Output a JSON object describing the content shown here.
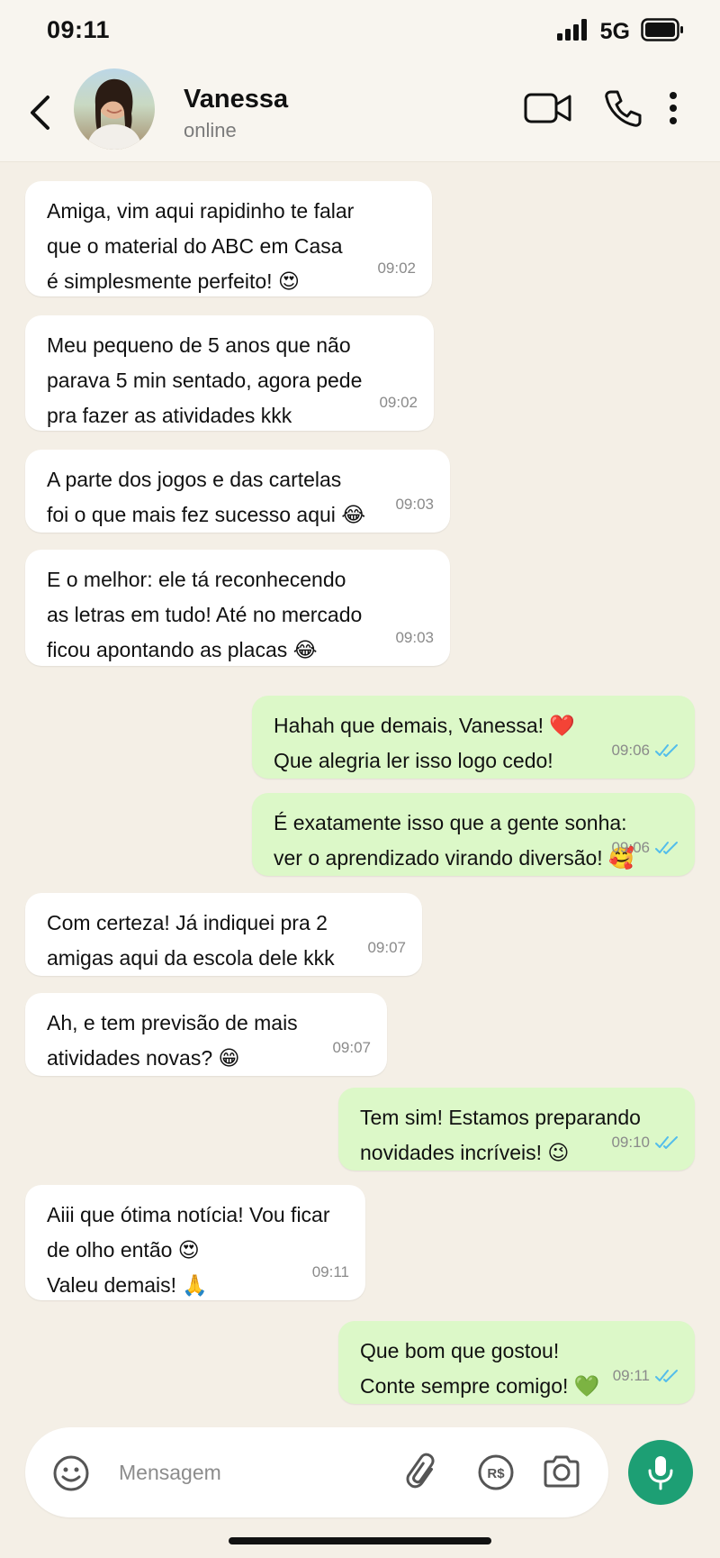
{
  "status_bar": {
    "time": "09:11",
    "network": "5G",
    "icons": [
      "signal-icon",
      "battery-icon"
    ]
  },
  "header": {
    "contact_name": "Vanessa",
    "contact_status": "online",
    "icons": [
      "back-icon",
      "video-call-icon",
      "phone-icon",
      "more-icon"
    ]
  },
  "messages": [
    {
      "direction": "in",
      "lines": [
        "Amiga, vim aqui rapidinho te falar",
        "que o material do ABC em Casa",
        "é simplesmente perfeito! 😍"
      ],
      "time": "09:02"
    },
    {
      "direction": "in",
      "lines": [
        "Meu pequeno de 5 anos que não",
        "parava 5 min sentado, agora pede",
        "pra fazer as atividades kkk"
      ],
      "time": "09:02"
    },
    {
      "direction": "in",
      "lines": [
        "A parte dos jogos e das cartelas",
        "foi o que mais fez sucesso aqui 😂"
      ],
      "time": "09:03"
    },
    {
      "direction": "in",
      "lines": [
        "E o melhor: ele tá reconhecendo",
        "as letras em tudo! Até no mercado",
        "ficou apontando as placas 😂"
      ],
      "time": "09:03"
    },
    {
      "direction": "out",
      "lines": [
        "Hahah que demais, Vanessa! ❤️",
        "Que alegria ler isso logo cedo!"
      ],
      "time": "09:06",
      "status": "read"
    },
    {
      "direction": "out",
      "lines": [
        "É exatamente isso que a gente sonha:",
        "ver o aprendizado virando diversão! 🥰"
      ],
      "time": "09:06",
      "status": "read"
    },
    {
      "direction": "in",
      "lines": [
        "Com certeza! Já indiquei pra 2",
        "amigas aqui da escola dele kkk"
      ],
      "time": "09:07"
    },
    {
      "direction": "in",
      "lines": [
        "Ah, e tem previsão de mais",
        "atividades novas? 😁"
      ],
      "time": "09:07"
    },
    {
      "direction": "out",
      "lines": [
        "Tem sim! Estamos preparando",
        "novidades incríveis! 😉"
      ],
      "time": "09:10",
      "status": "read"
    },
    {
      "direction": "in",
      "lines": [
        "Aiii que ótima notícia! Vou ficar",
        "de olho então 😍",
        "Valeu demais! 🙏"
      ],
      "time": "09:11"
    },
    {
      "direction": "out",
      "lines": [
        "Que bom que gostou!",
        "Conte sempre comigo! 💚"
      ],
      "time": "09:11",
      "status": "read"
    }
  ],
  "composer": {
    "placeholder": "Mensagem",
    "icons": [
      "emoji-icon",
      "attachment-icon",
      "payment-icon",
      "camera-icon",
      "mic-icon"
    ]
  },
  "colors": {
    "chat_background": "#f4efe6",
    "incoming_bubble": "#ffffff",
    "outgoing_bubble": "#dcf8c8",
    "read_ticks": "#53bdeb",
    "mic_button": "#1d9f74"
  }
}
